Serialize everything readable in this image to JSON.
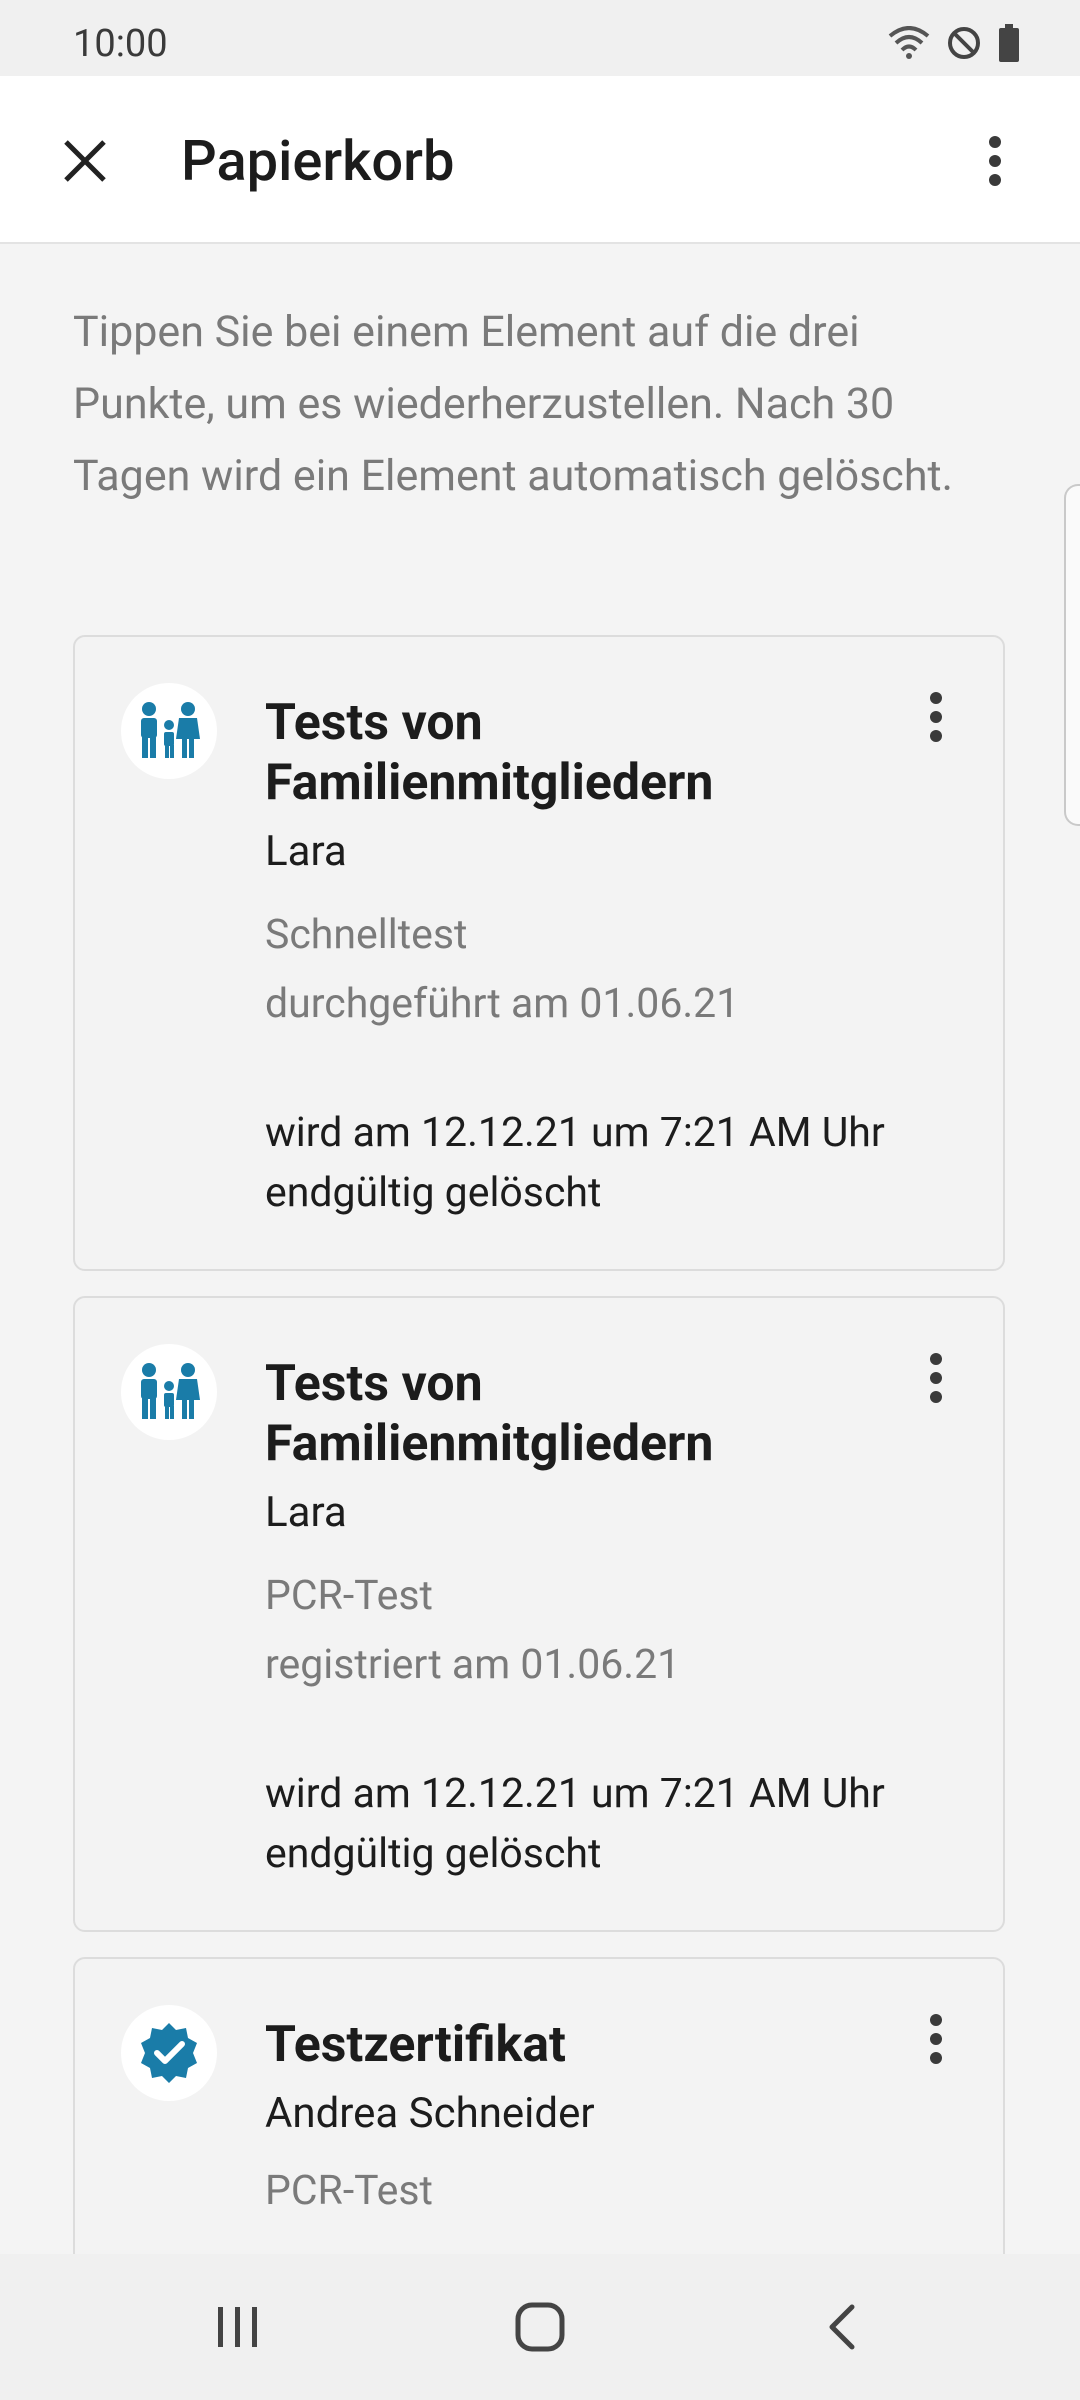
{
  "status": {
    "time": "10:00"
  },
  "appbar": {
    "title": "Papierkorb"
  },
  "intro": "Tippen Sie bei einem Element auf die drei Punkte, um es wiederherzustellen. Nach 30 Tagen wird ein Element automatisch gelöscht.",
  "colors": {
    "accent": "#1a7ca8",
    "card_bg": "#f3f3f3",
    "muted_text": "#7a7a7a"
  },
  "cards": [
    {
      "icon": "family-icon",
      "title": "Tests von Familienmitgliedern",
      "name": "Lara",
      "type": "Schnelltest",
      "date_line": "durchgeführt am 01.06.21",
      "delete_info": "wird am 12.12.21 um 7:21 AM Uhr endgültig gelöscht"
    },
    {
      "icon": "family-icon",
      "title": "Tests von Familienmitgliedern",
      "name": "Lara",
      "type": "PCR-Test",
      "date_line": "registriert am 01.06.21",
      "delete_info": "wird am 12.12.21 um 7:21 AM Uhr endgültig gelöscht"
    },
    {
      "icon": "verified-badge-icon",
      "title": "Testzertifikat",
      "name": "Andrea Schneider",
      "type": "PCR-Test"
    }
  ]
}
